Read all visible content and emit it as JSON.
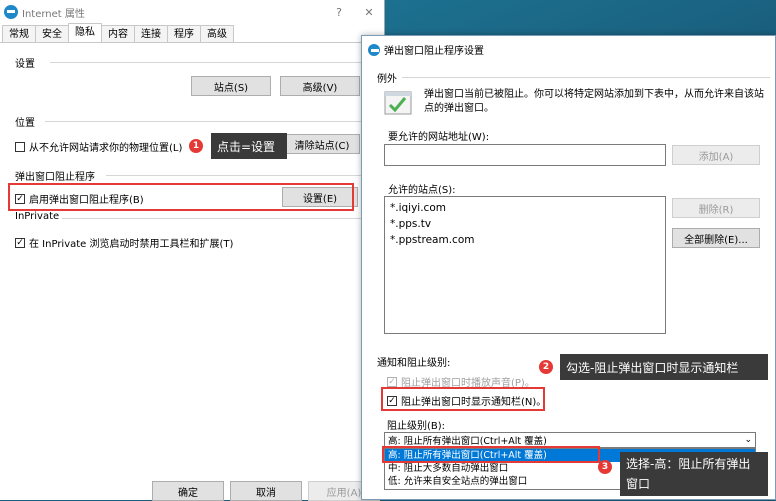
{
  "main_window": {
    "title": "Internet 属性",
    "help_symbol": "?",
    "close_symbol": "✕",
    "tabs": [
      "常规",
      "安全",
      "隐私",
      "内容",
      "连接",
      "程序",
      "高级"
    ],
    "active_tab": "隐私",
    "settings_group": "设置",
    "sites_button": "站点(S)",
    "advanced_button": "高级(V)",
    "location_group": "位置",
    "location_checkbox": "从不允许网站请求你的物理位置(L)",
    "clear_sites_button": "清除站点(C)",
    "popup_group": "弹出窗口阻止程序",
    "popup_checkbox": "启用弹出窗口阻止程序(B)",
    "popup_settings_button": "设置(E)",
    "inprivate_group": "InPrivate",
    "inprivate_checkbox": "在 InPrivate 浏览启动时禁用工具栏和扩展(T)",
    "ok_button": "确定",
    "cancel_button": "取消",
    "apply_button": "应用(A)"
  },
  "popup_dialog": {
    "title": "弹出窗口阻止程序设置",
    "exceptions_group": "例外",
    "description": "弹出窗口当前已被阻止。你可以将特定网站添加到下表中，从而允许来自该站点的弹出窗口。",
    "address_label": "要允许的网站地址(W):",
    "address_value": "",
    "add_button": "添加(A)",
    "allowed_label": "允许的站点(S):",
    "allowed_sites": [
      "*.iqiyi.com",
      "*.pps.tv",
      "*.ppstream.com"
    ],
    "remove_button": "删除(R)",
    "remove_all_button": "全部删除(E)...",
    "notify_group": "通知和阻止级别:",
    "sound_checkbox": "阻止弹出窗口时播放声音(P)。",
    "notify_checkbox": "阻止弹出窗口时显示通知栏(N)。",
    "level_label": "阻止级别(B):",
    "level_selected": "高: 阻止所有弹出窗口(Ctrl+Alt 覆盖)",
    "level_options": [
      "高: 阻止所有弹出窗口(Ctrl+Alt 覆盖)",
      "中: 阻止大多数自动弹出窗口",
      "低: 允许来自安全站点的弹出窗口"
    ]
  },
  "annotations": [
    {
      "num": "1",
      "text": "点击=设置"
    },
    {
      "num": "2",
      "text": "勾选-阻止弹出窗口时显示通知栏"
    },
    {
      "num": "3",
      "text": "选择-高：阻止所有弹出窗口"
    }
  ],
  "colors": {
    "highlight_red": "#e53935",
    "callout_bg": "#3a3a3a",
    "selection_blue": "#0078d7"
  }
}
